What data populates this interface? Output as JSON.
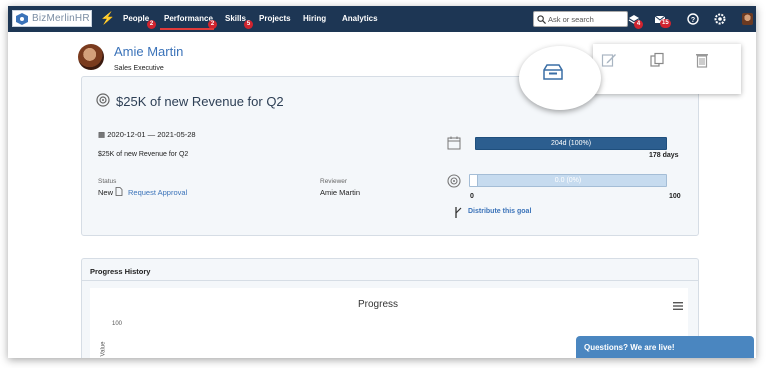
{
  "nav": {
    "logo_text": "BizMerlinHR",
    "items": [
      {
        "label": "People",
        "badge": "2"
      },
      {
        "label": "Performance",
        "badge": "2"
      },
      {
        "label": "Skills",
        "badge": "5"
      },
      {
        "label": "Projects"
      },
      {
        "label": "Hiring"
      },
      {
        "label": "Analytics"
      }
    ],
    "search_placeholder": "Ask or search",
    "icons": [
      {
        "name": "tasks-icon",
        "badge": "4"
      },
      {
        "name": "messages-icon",
        "badge": "15"
      },
      {
        "name": "help-icon"
      },
      {
        "name": "settings-icon"
      },
      {
        "name": "user-avatar"
      }
    ]
  },
  "profile": {
    "name": "Amie Martin",
    "role": "Sales Executive"
  },
  "goal": {
    "title": "$25K of new Revenue for Q2",
    "dates": "2020-12-01 — 2021-05-28",
    "description": "$25K of new Revenue for Q2",
    "status_label": "Status",
    "status_value": "New",
    "request_approval": "Request Approval",
    "reviewer_label": "Reviewer",
    "reviewer_value": "Amie Martin",
    "time_bar_label": "204d (100%)",
    "time_fraction": 1.0,
    "days_remaining": "178 days",
    "progress_bar_label": "0.0 (0%)",
    "progress_fraction": 0.0,
    "progress_min": "0",
    "progress_max": "100",
    "distribute_link": "Distribute this goal"
  },
  "history": {
    "header": "Progress History",
    "chart_title": "Progress",
    "y_top_tick": "100",
    "y_axis_label": "Value"
  },
  "toolbar": {
    "buttons": [
      "archive-icon",
      "edit-icon",
      "copy-icon",
      "delete-icon"
    ]
  },
  "chat": {
    "label": "Questions? We are live!"
  },
  "colors": {
    "nav_bg": "#1d3654",
    "accent": "#3b73b9",
    "bar_fill": "#2c5e8f",
    "badge": "#d0242f"
  }
}
